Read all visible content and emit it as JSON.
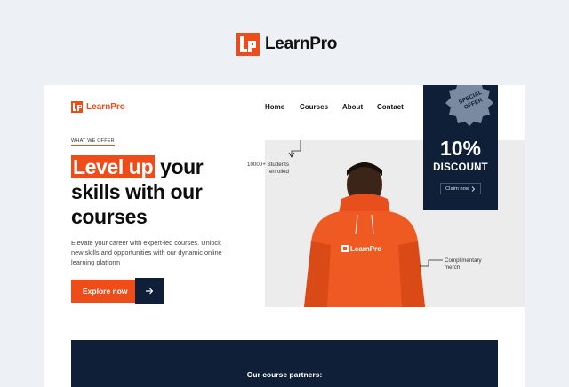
{
  "brand": {
    "name": "LearnPro",
    "logo_letters": "LP",
    "accent": "#ee4c19",
    "navy": "#0f1f38"
  },
  "nav": {
    "items": [
      {
        "label": "Home"
      },
      {
        "label": "Courses"
      },
      {
        "label": "About"
      },
      {
        "label": "Contact"
      }
    ]
  },
  "hero": {
    "eyebrow": "WHAT WE OFFER",
    "headline_highlight": "Level up",
    "headline_rest_1": " your",
    "headline_line_2": "skills with our",
    "headline_line_3": "courses",
    "subtitle": "Elevate your career with expert-led courses. Unlock new skills and opportunities with our dynamic online learning platform",
    "cta_label": "Explore now",
    "cta_icon": "arrow-right-icon"
  },
  "annotations": {
    "students": [
      "10000+ Students",
      "enrolled"
    ],
    "merch": [
      "Complimentary",
      "merch"
    ]
  },
  "hoodie_logo": "LearnPro",
  "promo": {
    "badge_line_1": "SPECIAL",
    "badge_line_2": "OFFER",
    "percent": "10%",
    "label": "DISCOUNT",
    "claim_label": "Claim now",
    "claim_icon": "chevron-right-icon"
  },
  "partners": {
    "label": "Our course partners:"
  }
}
